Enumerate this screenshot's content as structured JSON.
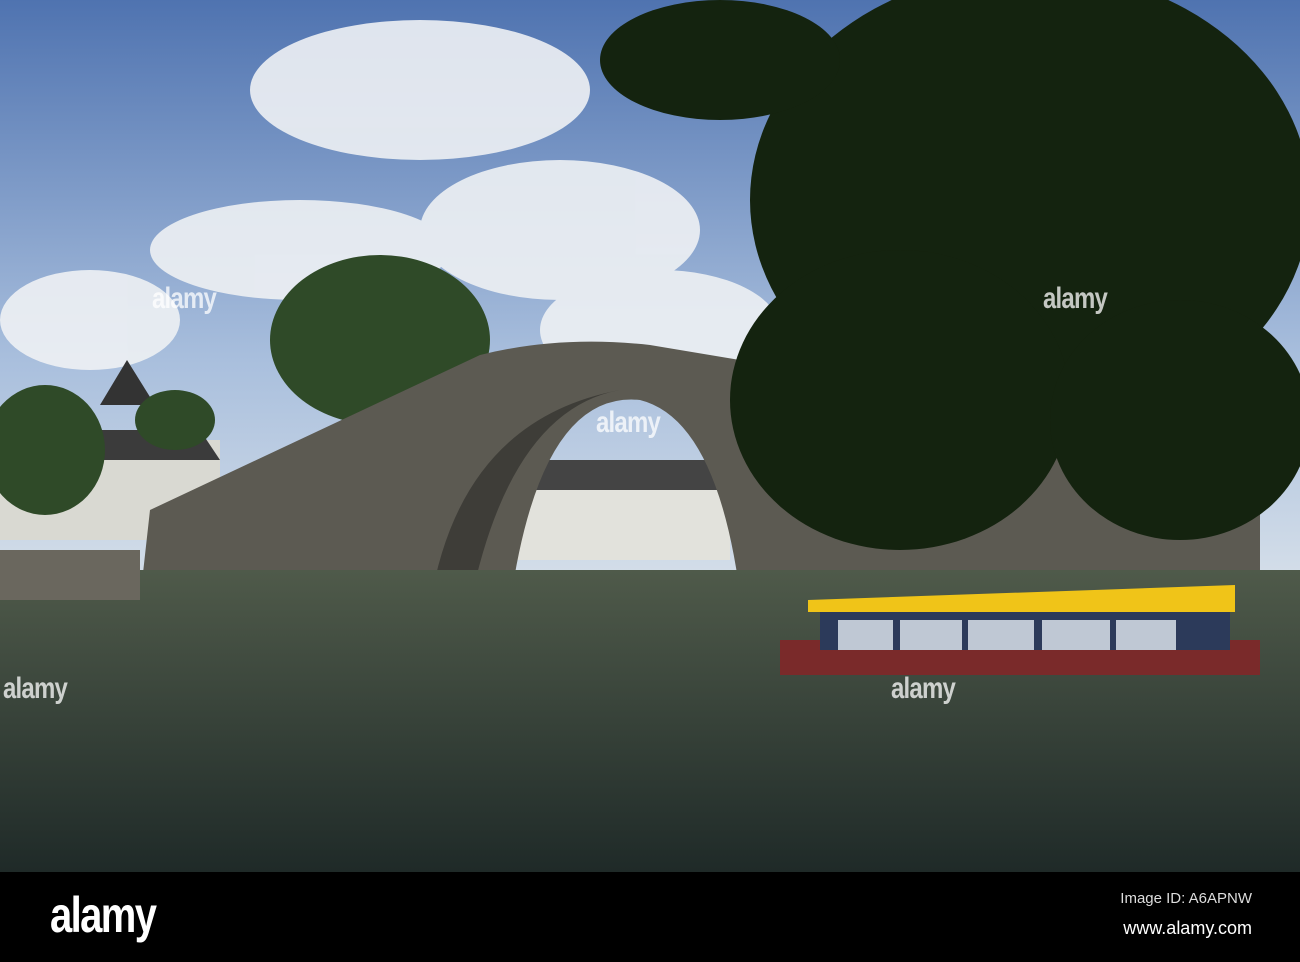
{
  "photo": {
    "subject": "Arched stone bridge over canal with yellow-roofed tour boat",
    "watermark_text": "alamy"
  },
  "footer": {
    "logo": "alamy",
    "image_id": "Image ID: A6APNW",
    "url": "www.alamy.com"
  }
}
